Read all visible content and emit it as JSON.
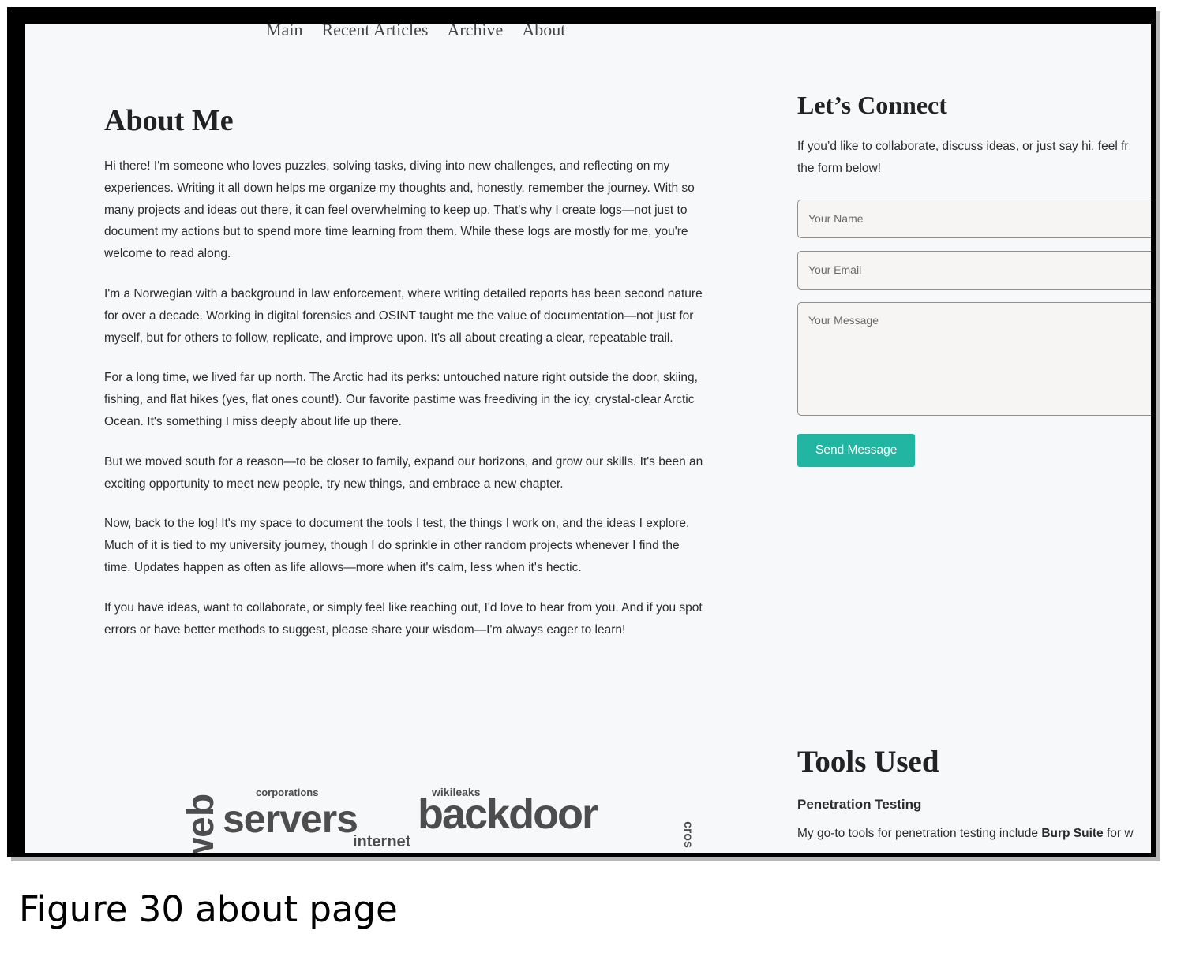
{
  "nav": {
    "items": [
      "Main",
      "Recent Articles",
      "Archive",
      "About"
    ]
  },
  "about": {
    "title": "About Me",
    "paragraphs": [
      "Hi there! I'm someone who loves puzzles, solving tasks, diving into new challenges, and reflecting on my experiences. Writing it all down helps me organize my thoughts and, honestly, remember the journey. With so many projects and ideas out there, it can feel overwhelming to keep up. That's why I create logs—not just to document my actions but to spend more time learning from them. While these logs are mostly for me, you're welcome to read along.",
      "I'm a Norwegian with a background in law enforcement, where writing detailed reports has been second nature for over a decade. Working in digital forensics and OSINT taught me the value of documentation—not just for myself, but for others to follow, replicate, and improve upon. It's all about creating a clear, repeatable trail.",
      "For a long time, we lived far up north. The Arctic had its perks: untouched nature right outside the door, skiing, fishing, and flat hikes (yes, flat ones count!). Our favorite pastime was freediving in the icy, crystal-clear Arctic Ocean. It's something I miss deeply about life up there.",
      "But we moved south for a reason—to be closer to family, expand our horizons, and grow our skills. It's been an exciting opportunity to meet new people, try new things, and embrace a new chapter.",
      "Now, back to the log! It's my space to document the tools I test, the things I work on, and the ideas I explore. Much of it is tied to my university journey, though I do sprinkle in other random projects whenever I find the time. Updates happen as often as life allows—more when it's calm, less when it's hectic.",
      "If you have ideas, want to collaborate, or simply feel like reaching out, I'd love to hear from you. And if you spot errors or have better methods to suggest, please share your wisdom—I'm always eager to learn!"
    ]
  },
  "connect": {
    "title": "Let’s Connect",
    "intro_line1": "If you’d like to collaborate, discuss ideas, or just say hi, feel fr",
    "intro_line2": "the form below!",
    "name_placeholder": "Your Name",
    "email_placeholder": "Your Email",
    "message_placeholder": "Your Message",
    "send_label": "Send Message"
  },
  "tools": {
    "title": "Tools Used",
    "category": "Penetration Testing",
    "desc_prefix": "My go-to tools for penetration testing include ",
    "desc_bold": "Burp Suite",
    "desc_suffix": " for w"
  },
  "wordcloud": {
    "words": [
      "web",
      "corporations",
      "servers",
      "internet",
      "wikileaks",
      "backdoor",
      "cros"
    ]
  },
  "caption": "Figure 30 about page"
}
